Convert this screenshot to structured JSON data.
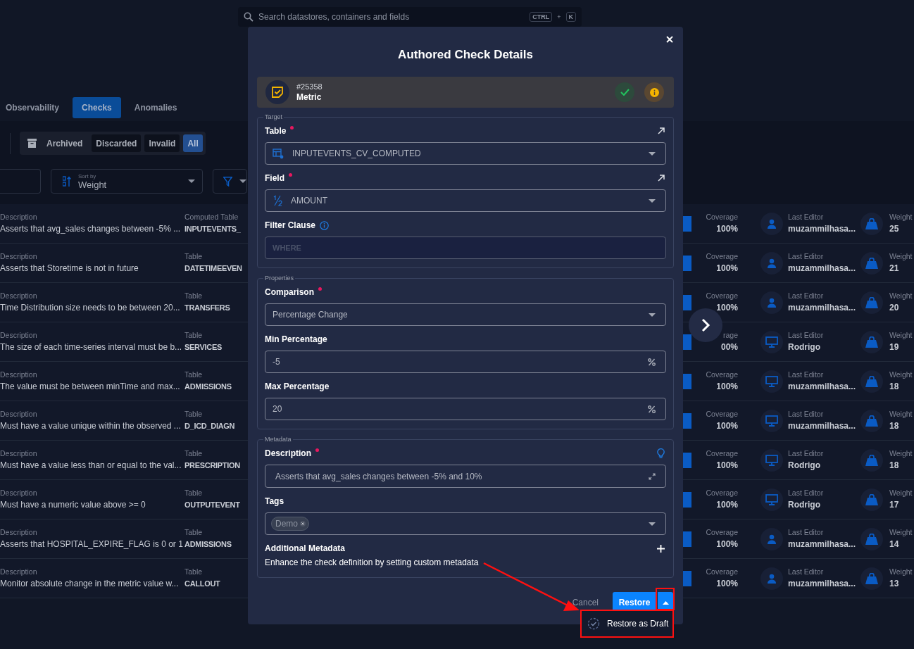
{
  "search": {
    "placeholder": "Search datastores, containers and fields",
    "keys": [
      "CTRL",
      "+",
      "K"
    ]
  },
  "tabs": [
    {
      "label": "Observability",
      "selected": false
    },
    {
      "label": "Checks",
      "selected": true
    },
    {
      "label": "Anomalies",
      "selected": false
    }
  ],
  "status_filter": {
    "label": "Archived",
    "options": [
      {
        "label": "Discarded",
        "selected": false
      },
      {
        "label": "Invalid",
        "selected": false
      },
      {
        "label": "All",
        "selected": true
      }
    ]
  },
  "sort": {
    "caption": "Sort by",
    "value": "Weight"
  },
  "rows": [
    {
      "description_label": "Description",
      "description": "Asserts that avg_sales changes between -5% ...",
      "table_label": "Computed Table",
      "table": "INPUTEVENTS_",
      "coverage_label": "Coverage",
      "coverage": "100%",
      "editor_label": "Last Editor",
      "editor": "muzammilhasa...",
      "kind": "user",
      "weight_label": "Weight",
      "weight": "25"
    },
    {
      "description_label": "Description",
      "description": "Asserts that Storetime is not in future",
      "table_label": "Table",
      "table": "DATETIMEEVEN",
      "coverage_label": "Coverage",
      "coverage": "100%",
      "editor_label": "Last Editor",
      "editor": "muzammilhasa...",
      "kind": "user",
      "weight_label": "Weight",
      "weight": "21"
    },
    {
      "description_label": "Description",
      "description": "Time Distribution size needs to be between 20...",
      "table_label": "Table",
      "table": "TRANSFERS",
      "coverage_label": "Coverage",
      "coverage": "100%",
      "editor_label": "Last Editor",
      "editor": "muzammilhasa...",
      "kind": "user",
      "weight_label": "Weight",
      "weight": "20"
    },
    {
      "description_label": "Description",
      "description": "The size of each time-series interval must be b...",
      "table_label": "Table",
      "table": "SERVICES",
      "coverage_label": "rage",
      "coverage": "00%",
      "editor_label": "Last Editor",
      "editor": "Rodrigo",
      "kind": "system",
      "weight_label": "Weight",
      "weight": "19"
    },
    {
      "description_label": "Description",
      "description": "The value must be between minTime and max...",
      "table_label": "Table",
      "table": "ADMISSIONS",
      "coverage_label": "Coverage",
      "coverage": "100%",
      "editor_label": "Last Editor",
      "editor": "muzammilhasa...",
      "kind": "system",
      "weight_label": "Weight",
      "weight": "18"
    },
    {
      "description_label": "Description",
      "description": "Must have a value unique within the observed ...",
      "table_label": "Table",
      "table": "D_ICD_DIAGN",
      "coverage_label": "Coverage",
      "coverage": "100%",
      "editor_label": "Last Editor",
      "editor": "muzammilhasa...",
      "kind": "system",
      "weight_label": "Weight",
      "weight": "18"
    },
    {
      "description_label": "Description",
      "description": "Must have a value less than or equal to the val...",
      "table_label": "Table",
      "table": "PRESCRIPTION",
      "coverage_label": "Coverage",
      "coverage": "100%",
      "editor_label": "Last Editor",
      "editor": "Rodrigo",
      "kind": "system",
      "weight_label": "Weight",
      "weight": "18"
    },
    {
      "description_label": "Description",
      "description": "Must have a numeric value above >= 0",
      "table_label": "Table",
      "table": "OUTPUTEVENT",
      "coverage_label": "Coverage",
      "coverage": "100%",
      "editor_label": "Last Editor",
      "editor": "Rodrigo",
      "kind": "system",
      "weight_label": "Weight",
      "weight": "17"
    },
    {
      "description_label": "Description",
      "description": "Asserts that HOSPITAL_EXPIRE_FLAG is 0 or 1",
      "table_label": "Table",
      "table": "ADMISSIONS",
      "coverage_label": "Coverage",
      "coverage": "100%",
      "editor_label": "Last Editor",
      "editor": "muzammilhasa...",
      "kind": "user",
      "weight_label": "Weight",
      "weight": "14"
    },
    {
      "description_label": "Description",
      "description": "Monitor absolute change in the metric value w...",
      "table_label": "Table",
      "table": "CALLOUT",
      "coverage_label": "Coverage",
      "coverage": "100%",
      "editor_label": "Last Editor",
      "editor": "muzammilhasa...",
      "kind": "user",
      "weight_label": "Weight",
      "weight": "13"
    }
  ],
  "modal": {
    "title": "Authored Check Details",
    "check": {
      "id": "#25358",
      "type": "Metric"
    },
    "sections": [
      {
        "legend": "Target",
        "fields": [
          {
            "kind": "table-select",
            "label": "Table",
            "required": true,
            "openable": true,
            "value": "INPUTEVENTS_CV_COMPUTED"
          },
          {
            "kind": "field-select",
            "label": "Field",
            "required": true,
            "openable": true,
            "value": "AMOUNT"
          },
          {
            "kind": "text",
            "label": "Filter Clause",
            "required": false,
            "info": true,
            "placeholder": "WHERE"
          }
        ]
      },
      {
        "legend": "Properties",
        "fields": [
          {
            "kind": "select",
            "label": "Comparison",
            "required": true,
            "value": "Percentage Change"
          },
          {
            "kind": "percent",
            "label": "Min Percentage",
            "required": false,
            "value": "-5"
          },
          {
            "kind": "percent",
            "label": "Max Percentage",
            "required": false,
            "value": "20"
          }
        ]
      },
      {
        "legend": "Metadata",
        "fields": [
          {
            "kind": "textarea",
            "label": "Description",
            "required": true,
            "suggestions": true,
            "value": "Asserts that avg_sales changes between -5% and 10%"
          },
          {
            "kind": "tags",
            "label": "Tags",
            "required": false,
            "tags": [
              {
                "label": "Demo"
              }
            ]
          },
          {
            "kind": "note",
            "label": "Additional Metadata",
            "required": false,
            "addable": true,
            "text": "Enhance the check definition by setting custom metadata"
          }
        ]
      }
    ],
    "cancel": "Cancel",
    "primary": "Restore",
    "menu": [
      {
        "label": "Restore as Draft"
      }
    ]
  }
}
